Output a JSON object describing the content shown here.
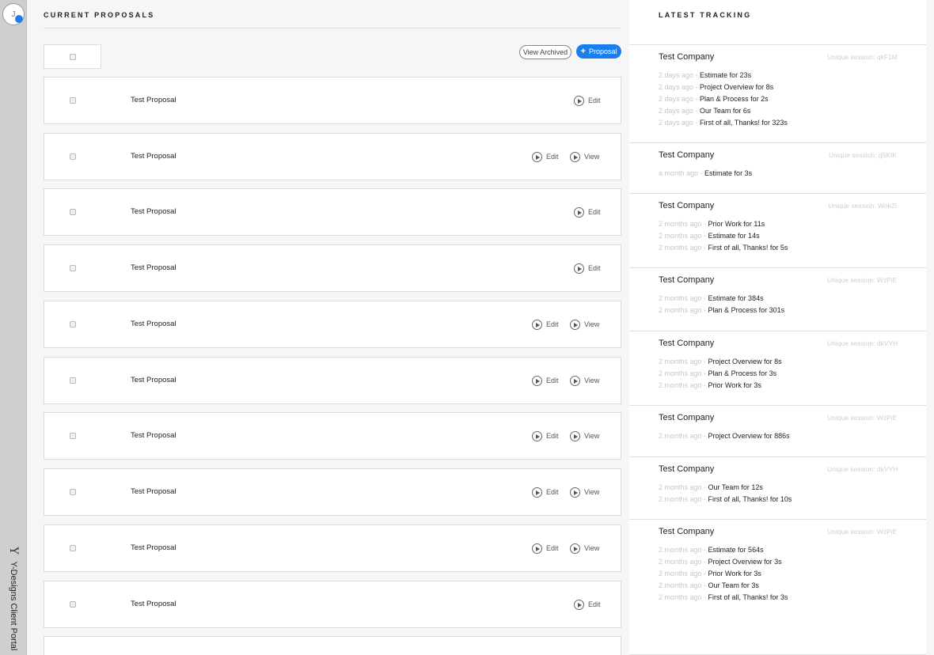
{
  "sidebar": {
    "avatar_initial": "J",
    "brand_logo": "Y",
    "brand_text": "Y-Designs Client Portal"
  },
  "proposals": {
    "title": "CURRENT PROPOSALS",
    "view_archived_label": "View Archived",
    "new_proposal_label": "Proposal",
    "edit_label": "Edit",
    "view_label": "View",
    "rows": [
      {
        "title": "Test Proposal",
        "has_view": false
      },
      {
        "title": "Test Proposal",
        "has_view": true
      },
      {
        "title": "Test Proposal",
        "has_view": false
      },
      {
        "title": "Test Proposal",
        "has_view": false
      },
      {
        "title": "Test Proposal",
        "has_view": true
      },
      {
        "title": "Test Proposal",
        "has_view": true
      },
      {
        "title": "Test Proposal",
        "has_view": true
      },
      {
        "title": "Test Proposal",
        "has_view": true
      },
      {
        "title": "Test Proposal",
        "has_view": true
      },
      {
        "title": "Test Proposal",
        "has_view": false
      },
      {
        "title": "",
        "has_view": false
      }
    ]
  },
  "tracking": {
    "title": "LATEST TRACKING",
    "entries": [
      {
        "company": "Test Company",
        "session": "Unique session: qkF1M",
        "events": [
          {
            "ago": "2 days ago",
            "what": "Estimate for 23s"
          },
          {
            "ago": "2 days ago",
            "what": "Project Overview for 8s"
          },
          {
            "ago": "2 days ago",
            "what": "Plan & Process for 2s"
          },
          {
            "ago": "2 days ago",
            "what": "Our Team for 6s"
          },
          {
            "ago": "2 days ago",
            "what": "First of all, Thanks! for 323s"
          }
        ]
      },
      {
        "company": "Test Company",
        "session": "Unique session: g5KfK",
        "events": [
          {
            "ago": "a month ago",
            "what": "Estimate for 3s"
          }
        ]
      },
      {
        "company": "Test Company",
        "session": "Unique session: WokZi",
        "events": [
          {
            "ago": "2 months ago",
            "what": "Prior Work for 11s"
          },
          {
            "ago": "2 months ago",
            "what": "Estimate for 14s"
          },
          {
            "ago": "2 months ago",
            "what": "First of all, Thanks! for 5s"
          }
        ]
      },
      {
        "company": "Test Company",
        "session": "Unique session: WzPiE",
        "events": [
          {
            "ago": "2 months ago",
            "what": "Estimate for 384s"
          },
          {
            "ago": "2 months ago",
            "what": "Plan & Process for 301s"
          }
        ]
      },
      {
        "company": "Test Company",
        "session": "Unique session: dkVYH",
        "events": [
          {
            "ago": "2 months ago",
            "what": "Project Overview for 8s"
          },
          {
            "ago": "2 months ago",
            "what": "Plan & Process for 3s"
          },
          {
            "ago": "2 months ago",
            "what": "Prior Work for 3s"
          }
        ]
      },
      {
        "company": "Test Company",
        "session": "Unique session: WzPiE",
        "events": [
          {
            "ago": "2 months ago",
            "what": "Project Overview for 886s"
          }
        ]
      },
      {
        "company": "Test Company",
        "session": "Unique session: dkVYH",
        "events": [
          {
            "ago": "2 months ago",
            "what": "Our Team for 12s"
          },
          {
            "ago": "2 months ago",
            "what": "First of all, Thanks! for 10s"
          }
        ]
      },
      {
        "company": "Test Company",
        "session": "Unique session: WzPiE",
        "events": [
          {
            "ago": "2 months ago",
            "what": "Estimate for 564s"
          },
          {
            "ago": "2 months ago",
            "what": "Project Overview for 3s"
          },
          {
            "ago": "2 months ago",
            "what": "Prior Work for 3s"
          },
          {
            "ago": "2 months ago",
            "what": "Our Team for 3s"
          },
          {
            "ago": "2 months ago",
            "what": "First of all, Thanks! for 3s"
          }
        ]
      }
    ]
  },
  "colors": {
    "accent": "#1a7ef0",
    "sidebar": "#cfcfcf",
    "muted_text": "#c7c7c7"
  }
}
